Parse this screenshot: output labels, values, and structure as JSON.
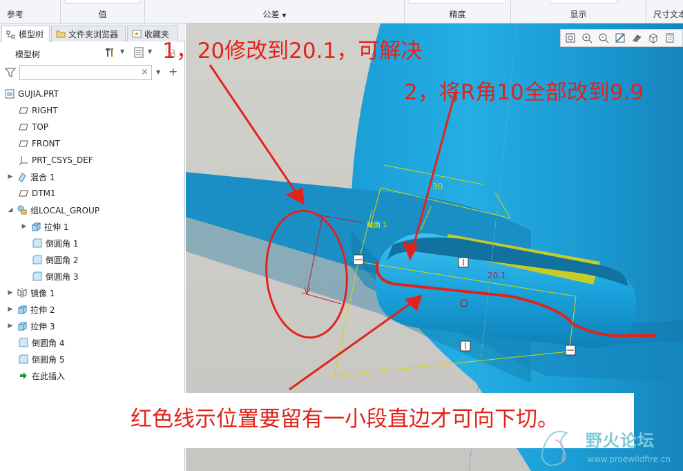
{
  "ribbon": {
    "cols": [
      "参考",
      "值",
      "公差",
      "精度",
      "显示",
      "尺寸文本"
    ]
  },
  "left_panel": {
    "tabs": [
      "模型树",
      "文件夹浏览器",
      "收藏夹"
    ],
    "tree_title": "模型树",
    "filter_placeholder": "",
    "tree": [
      {
        "label": "GUJIA.PRT",
        "icon": "part-icon"
      },
      {
        "label": "RIGHT",
        "icon": "datum-plane-icon"
      },
      {
        "label": "TOP",
        "icon": "datum-plane-icon"
      },
      {
        "label": "FRONT",
        "icon": "datum-plane-icon"
      },
      {
        "label": "PRT_CSYS_DEF",
        "icon": "csys-icon"
      },
      {
        "label": "混合 1",
        "icon": "blend-icon"
      },
      {
        "label": "DTM1",
        "icon": "datum-plane-icon"
      },
      {
        "label": "组LOCAL_GROUP",
        "icon": "group-icon"
      },
      {
        "label": "拉伸 1",
        "icon": "extrude-icon"
      },
      {
        "label": "倒圆角 1",
        "icon": "round-icon"
      },
      {
        "label": "倒圆角 2",
        "icon": "round-icon"
      },
      {
        "label": "倒圆角 3",
        "icon": "round-icon"
      },
      {
        "label": "镜像 1",
        "icon": "mirror-icon"
      },
      {
        "label": "拉伸 2",
        "icon": "extrude-icon"
      },
      {
        "label": "拉伸 3",
        "icon": "extrude-icon"
      },
      {
        "label": "倒圆角 4",
        "icon": "round-icon"
      },
      {
        "label": "倒圆角 5",
        "icon": "round-icon"
      },
      {
        "label": "在此插入",
        "icon": "insert-arrow-icon"
      }
    ]
  },
  "viewport": {
    "annotations": {
      "a1": "1，20修改到20.1，可解决",
      "a2": "2，将R角10全部改到9.9",
      "a3": "红色线示位置要留有一小段直边才可向下切。"
    },
    "dims": {
      "d30": "30",
      "d201": "20.1",
      "sec": "截面 1"
    },
    "watermark": {
      "title": "野火论坛",
      "url": "www.proewildfire.cn"
    }
  },
  "colors": {
    "model_blue": "#1fa2d8",
    "annotation_red": "#e2231a",
    "sketch_yellow": "#d8d800"
  }
}
